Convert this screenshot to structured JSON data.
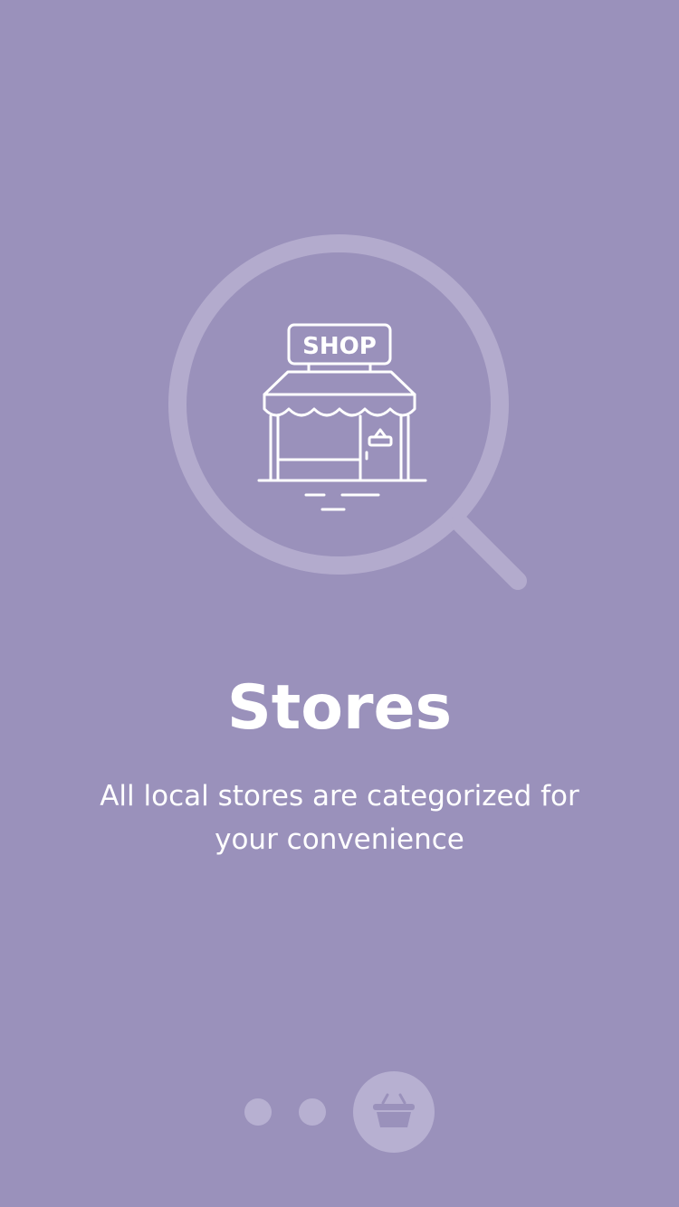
{
  "onboarding": {
    "illustration": {
      "icon": "store-search-icon",
      "sign_text": "SHOP"
    },
    "title": "Stores",
    "description": "All local stores are categorized for your convenience"
  },
  "pager": {
    "total_pages": 3,
    "current_page": 3,
    "active_icon": "basket-icon"
  },
  "colors": {
    "background": "#9a91bb",
    "accent_light": "#b7b0d1",
    "text": "#ffffff"
  }
}
